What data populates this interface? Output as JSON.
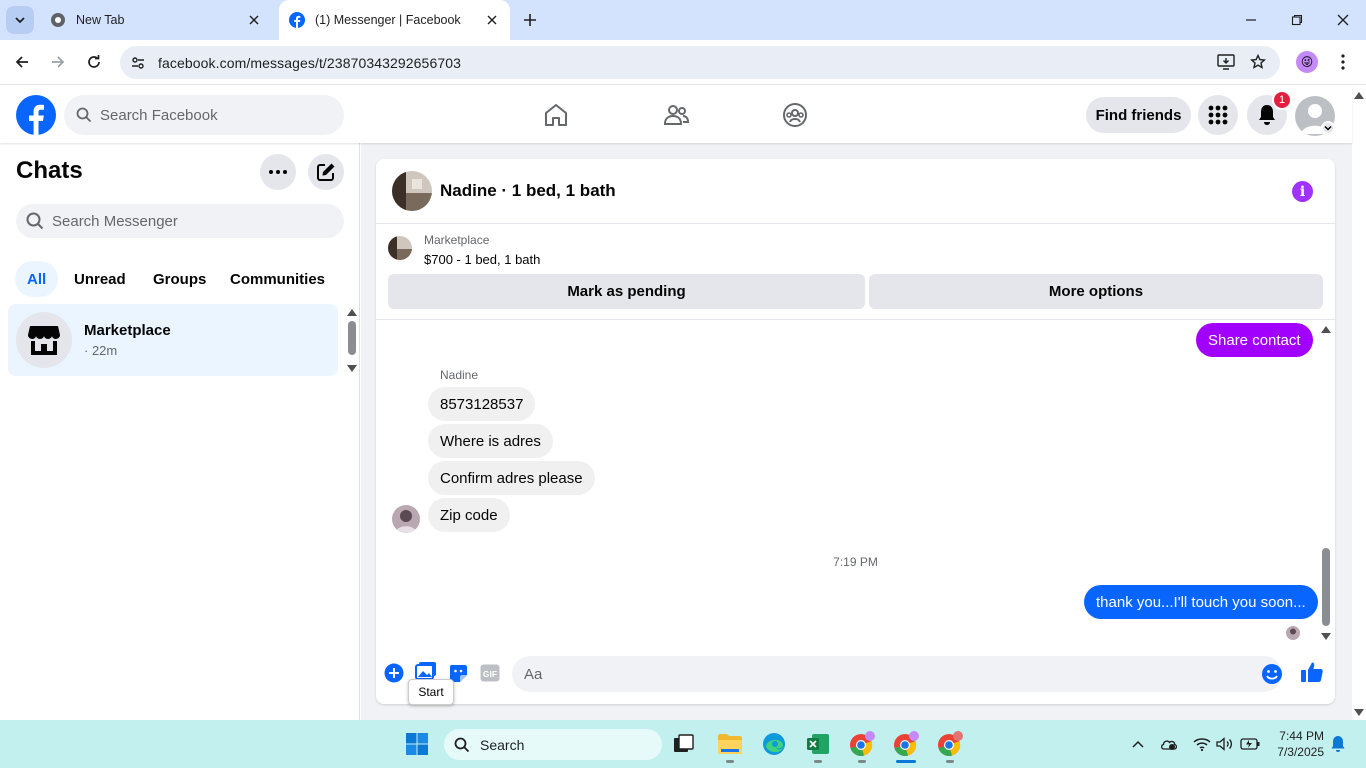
{
  "browser": {
    "tabs": [
      {
        "title": "New Tab",
        "active": false
      },
      {
        "title": "(1) Messenger | Facebook",
        "active": true
      }
    ],
    "url": "facebook.com/messages/t/23870343292656703"
  },
  "fb_header": {
    "search_placeholder": "Search Facebook",
    "find_friends": "Find friends",
    "notification_count": "1"
  },
  "chats": {
    "title": "Chats",
    "search_placeholder": "Search Messenger",
    "filters": [
      "All",
      "Unread",
      "Groups",
      "Communities"
    ],
    "active_filter": "All",
    "items": [
      {
        "name": "Marketplace",
        "time": "· 22m"
      }
    ]
  },
  "conversation": {
    "title": "Nadine · 1 bed, 1 bath",
    "marketplace": {
      "label": "Marketplace",
      "listing": "$700 - 1 bed, 1 bath",
      "mark_pending": "Mark as pending",
      "more_options": "More options"
    },
    "messages": {
      "share_contact": "Share contact",
      "sender": "Nadine",
      "incoming": [
        "8573128537",
        "Where is adres",
        "Confirm adres please",
        "Zip code"
      ],
      "timestamp": "7:19 PM",
      "outgoing": "thank you...I'll touch you soon..."
    },
    "composer_placeholder": "Aa",
    "tooltip": "Start"
  },
  "taskbar": {
    "search_label": "Search",
    "time": "7:44 PM",
    "date": "7/3/2025"
  },
  "colors": {
    "fb_blue": "#0866ff",
    "messenger_purple": "#a100ff",
    "taskbar": "#c2f0ee"
  }
}
